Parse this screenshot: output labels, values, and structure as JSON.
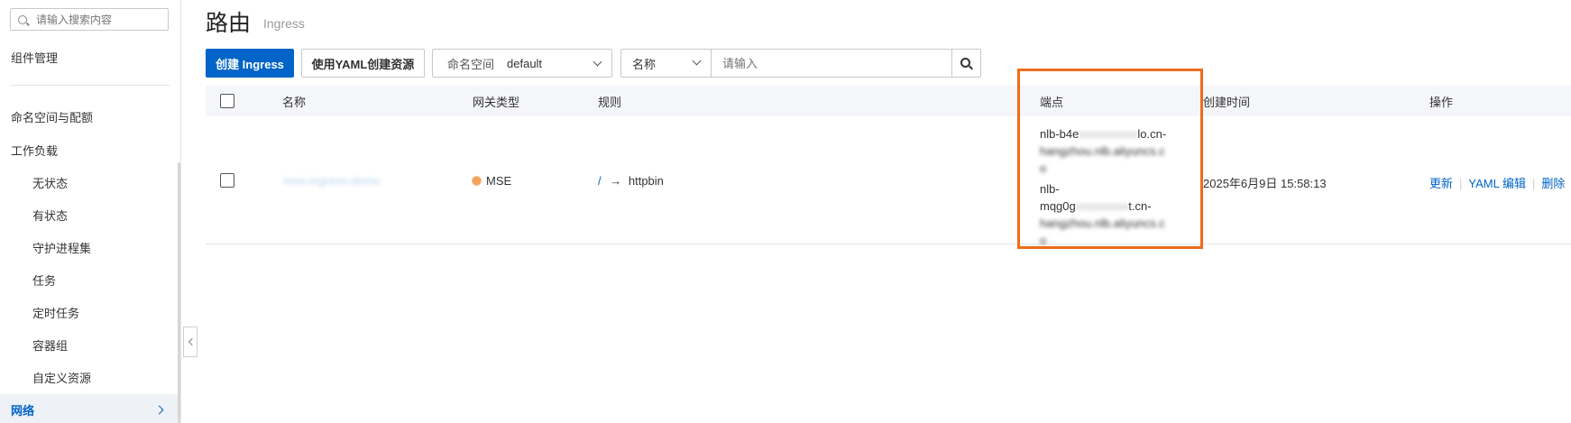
{
  "sidebar": {
    "search_placeholder": "请输入搜索内容",
    "items": [
      {
        "label": "组件管理"
      },
      {
        "label": "命名空间与配额"
      },
      {
        "label": "工作负载"
      },
      {
        "label": "无状态"
      },
      {
        "label": "有状态"
      },
      {
        "label": "守护进程集"
      },
      {
        "label": "任务"
      },
      {
        "label": "定时任务"
      },
      {
        "label": "容器组"
      },
      {
        "label": "自定义资源"
      },
      {
        "label": "网络"
      }
    ]
  },
  "header": {
    "title": "路由",
    "subtitle": "Ingress"
  },
  "toolbar": {
    "create_label": "创建 Ingress",
    "yaml_create_label": "使用YAML创建资源",
    "namespace_label": "命名空间",
    "namespace_value": "default",
    "filter_field": "名称",
    "filter_placeholder": "请输入"
  },
  "table": {
    "columns": [
      "名称",
      "网关类型",
      "规则",
      "端点",
      "创建时间",
      "操作"
    ],
    "rows": [
      {
        "name": "mse-ingress-demo",
        "gateway_type": "MSE",
        "rule_path": "/",
        "rule_arrow": "→",
        "rule_target": "httpbin",
        "endpoints": [
          {
            "line1_prefix": "nlb-b4e",
            "line1_blur": "xxxxxxxxxx",
            "line1_suffix": "lo.cn-",
            "line2_blur": "hangzhou.nlb.aliyuncs.c",
            "line3_blur": "o"
          },
          {
            "line1_prefix": "nlb-",
            "line2_prefix": "mqg0g",
            "line2_blur": "xxxxxxxxx",
            "line2_suffix": "t.cn-",
            "line3_blur": "hangzhou.nlb.aliyuncs.c",
            "line4_blur": "o"
          }
        ],
        "created": "2025年6月9日 15:58:13",
        "actions": {
          "update": "更新",
          "yaml_edit": "YAML 编辑",
          "delete": "删除"
        }
      }
    ]
  },
  "colors": {
    "primary": "#0064c8",
    "highlight": "#ef6c1b",
    "mse": "#f3a35a"
  }
}
